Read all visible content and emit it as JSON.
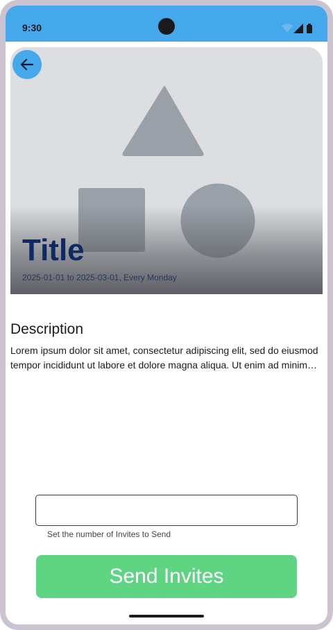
{
  "status_bar": {
    "time": "9:30",
    "icons": [
      "wifi-icon",
      "signal-icon",
      "battery-icon"
    ],
    "color": "#44a8ea"
  },
  "hero": {
    "title": "Title",
    "subtitle": "2025-01-01 to 2025-03-01, Every Monday",
    "placeholder_shapes": [
      "triangle-shape",
      "square-shape",
      "circle-shape"
    ],
    "back_icon": "arrow-back-icon"
  },
  "description": {
    "heading": "Description",
    "body": "Lorem ipsum dolor sit amet, consectetur adipiscing elit, sed do eiusmod tempor incididunt ut labore et dolore magna aliqua. Ut enim ad minim veniam, quis nostrud exercitation ullamco laboris nisi ut aliquip ex ea commodo consequat."
  },
  "invites": {
    "value": "",
    "helper_text": "Set the number of Invites to Send",
    "send_label": "Send Invites",
    "send_color": "#5fd584"
  }
}
